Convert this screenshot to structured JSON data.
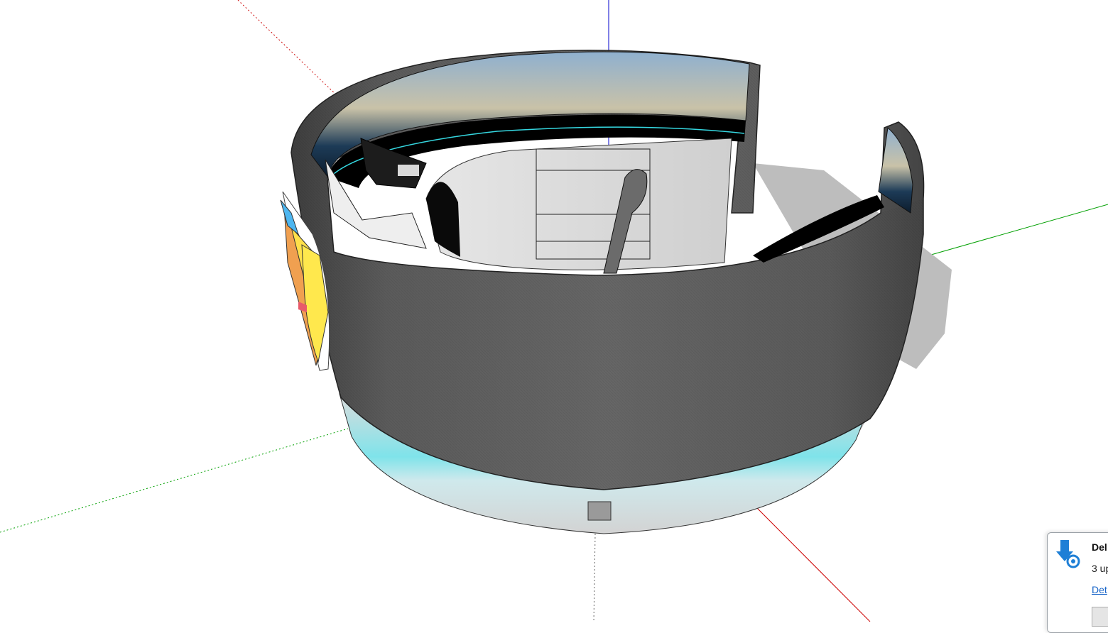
{
  "window": {
    "title": "",
    "background": "#ffffff"
  },
  "axes": {
    "red": "#cc0000",
    "green": "#00a000",
    "blue": "#0000cc"
  },
  "model": {
    "fabric_color": "#5a5a5a",
    "base_color": "#d7d7d7",
    "glow_color": "#7fe3ea",
    "sky_color": "#6b8bb0",
    "icons": [
      "sky-screen-icon",
      "phone-icon",
      "chair-icon",
      "decal-icon"
    ]
  },
  "notification": {
    "title": "Del",
    "body": "3 up",
    "link": "Det",
    "icon": "update-gear-icon"
  }
}
